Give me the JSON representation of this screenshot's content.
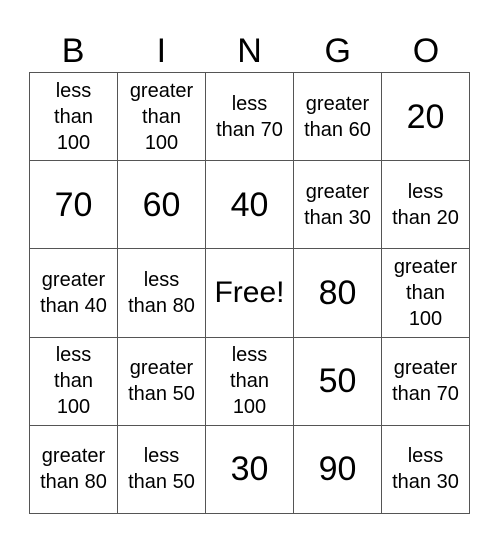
{
  "header": {
    "letters": [
      "B",
      "I",
      "N",
      "G",
      "O"
    ]
  },
  "board": {
    "rows": [
      [
        {
          "text": "less\nthan\n100",
          "style": "small"
        },
        {
          "text": "greater\nthan\n100",
          "style": "small"
        },
        {
          "text": "less\nthan 70",
          "style": "small"
        },
        {
          "text": "greater\nthan 60",
          "style": "small"
        },
        {
          "text": "20",
          "style": "big"
        }
      ],
      [
        {
          "text": "70",
          "style": "big"
        },
        {
          "text": "60",
          "style": "big"
        },
        {
          "text": "40",
          "style": "big"
        },
        {
          "text": "greater\nthan 30",
          "style": "small"
        },
        {
          "text": "less\nthan 20",
          "style": "small"
        }
      ],
      [
        {
          "text": "greater\nthan 40",
          "style": "small"
        },
        {
          "text": "less\nthan 80",
          "style": "small"
        },
        {
          "text": "Free!",
          "style": "free"
        },
        {
          "text": "80",
          "style": "big"
        },
        {
          "text": "greater\nthan\n100",
          "style": "small"
        }
      ],
      [
        {
          "text": "less\nthan\n100",
          "style": "small"
        },
        {
          "text": "greater\nthan 50",
          "style": "small"
        },
        {
          "text": "less\nthan\n100",
          "style": "small"
        },
        {
          "text": "50",
          "style": "big"
        },
        {
          "text": "greater\nthan 70",
          "style": "small"
        }
      ],
      [
        {
          "text": "greater\nthan 80",
          "style": "small"
        },
        {
          "text": "less\nthan 50",
          "style": "small"
        },
        {
          "text": "30",
          "style": "big"
        },
        {
          "text": "90",
          "style": "big"
        },
        {
          "text": "less\nthan 30",
          "style": "small"
        }
      ]
    ]
  },
  "colors": {
    "grid_line": "#555555",
    "text": "#000000",
    "background": "#ffffff"
  }
}
